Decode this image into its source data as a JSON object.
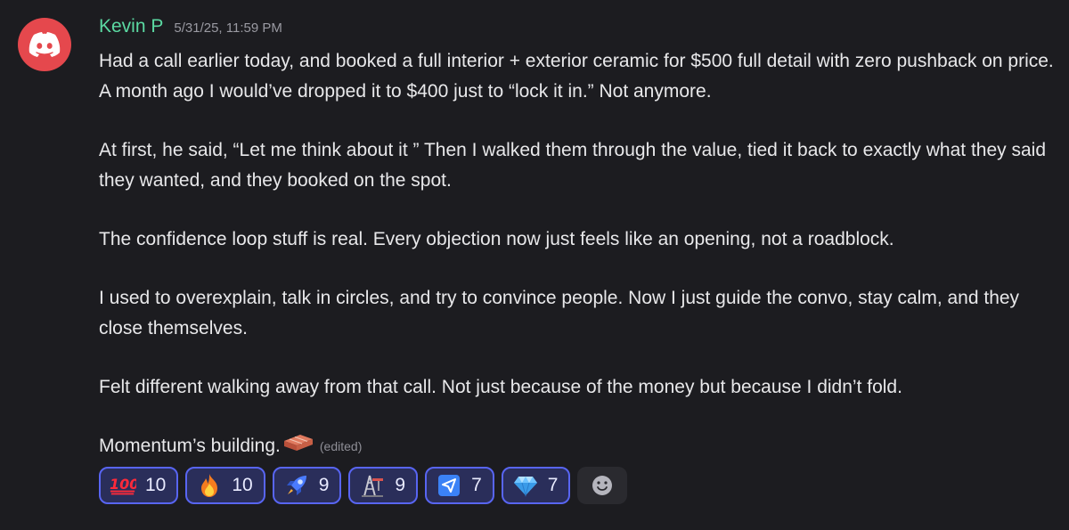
{
  "author": {
    "name": "Kevin P",
    "timestamp": "5/31/25, 11:59 PM",
    "name_color": "#5bd9a2",
    "avatar_color": "#e5484d",
    "avatar_icon": "discord-logo-icon"
  },
  "message": {
    "paragraphs": [
      "Had a call earlier today, and booked a full interior + exterior ceramic for $500 full detail with zero pushback on price. A month ago I would’ve dropped it to $400 just to “lock it in.” Not anymore.",
      "At first, he said, “Let me think about it ” Then I  walked them through the value, tied it back to exactly what they said they wanted, and they booked on the spot.",
      "The confidence loop stuff is real. Every objection now just feels like an opening, not a roadblock.",
      "I used to overexplain, talk in circles, and try to convince people. Now I just guide the convo, stay calm, and they close themselves.",
      "Felt different walking away from that call. Not just because of the money but because I didn’t fold."
    ],
    "last_line": "Momentum’s building.",
    "last_line_emoji": "brick-icon",
    "edited_label": "(edited)"
  },
  "reactions": [
    {
      "emoji": "hundred-points-icon",
      "count": "10"
    },
    {
      "emoji": "fire-icon",
      "count": "10"
    },
    {
      "emoji": "rocket-icon",
      "count": "9"
    },
    {
      "emoji": "oil-derrick-icon",
      "count": "9"
    },
    {
      "emoji": "send-arrow-icon",
      "count": "7"
    },
    {
      "emoji": "gem-icon",
      "count": "7"
    }
  ],
  "add_reaction_icon": "smiley-add-reaction-icon",
  "colors": {
    "background": "#1c1c20",
    "reaction_border": "#5865f2",
    "reaction_fill": "#2a2e5a"
  }
}
